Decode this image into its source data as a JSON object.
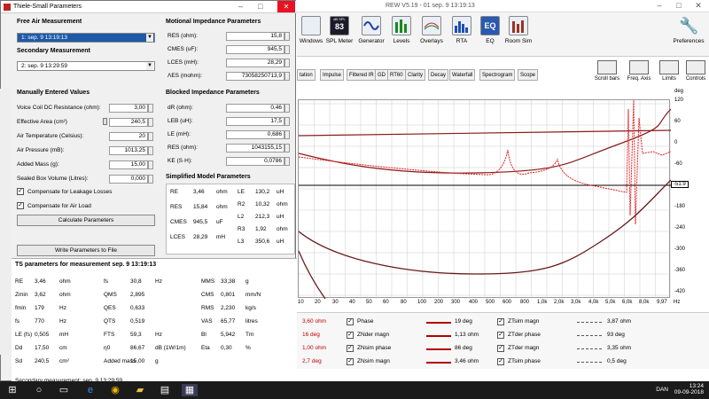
{
  "app": {
    "title": "REW V5.19 - 01 sep. 9 13:19:13",
    "toolbar": [
      {
        "label": "Windows",
        "icon": "windows-icon"
      },
      {
        "label": "SPL Meter",
        "icon": "spl-meter-icon",
        "value": "83",
        "unit": "dB SPL"
      },
      {
        "label": "Generator",
        "icon": "generator-icon"
      },
      {
        "label": "Levels",
        "icon": "levels-icon"
      },
      {
        "label": "Overlays",
        "icon": "overlays-icon"
      },
      {
        "label": "RTA",
        "icon": "rta-icon"
      },
      {
        "label": "EQ",
        "icon": "eq-icon"
      },
      {
        "label": "Room Sim",
        "icon": "room-sim-icon"
      }
    ],
    "preferences": "Preferences",
    "tabs": [
      "tation",
      "Impulse",
      "Filtered IR",
      "GD",
      "RT60",
      "Clarity",
      "Decay",
      "Waterfall",
      "Spectrogram",
      "Scope"
    ],
    "right_tools": [
      "Scroll bars",
      "Freq. Axis",
      "Limits",
      "Controls"
    ],
    "graph": {
      "right_unit": "deg",
      "right_ticks": [
        "120",
        "60",
        "0",
        "-60",
        "-120",
        "-180",
        "-240",
        "-300",
        "-360",
        "-420"
      ],
      "marker": "-51.9",
      "x_ticks": [
        "10",
        "20",
        "30",
        "40",
        "50",
        "60",
        "80",
        "100",
        "200",
        "300",
        "400",
        "500",
        "600",
        "800",
        "1,0k",
        "2,0k",
        "3,0k",
        "4,0k",
        "5,0k",
        "6,0k",
        "8,0k",
        "9,97",
        "Hz"
      ]
    },
    "legend": [
      {
        "left_value": "3,60 ohm",
        "name": "Phase",
        "value": "19 deg",
        "name2": "ZTsim magn",
        "value2": "3,87 ohm"
      },
      {
        "left_value": "16 deg",
        "name": "ZNder magn",
        "value": "1,13 ohm",
        "name2": "ZTder phase",
        "value2": "93 deg"
      },
      {
        "left_value": "1,00 ohm",
        "name": "ZNsim phase",
        "value": "86 deg",
        "name2": "ZTder magn",
        "value2": "3,35 ohm"
      },
      {
        "left_value": "2,7 deg",
        "name": "ZNsim magn",
        "value": "3,46 ohm",
        "name2": "ZTsim phase",
        "value2": "0,5 deg"
      }
    ]
  },
  "dialog": {
    "title": "Thiele-Small Parameters",
    "free_air": {
      "heading": "Free Air Measurement",
      "value": "1: sep. 9 13:19:13"
    },
    "secondary": {
      "heading": "Secondary Measurement",
      "value": "2: sep. 9 13:29:59"
    },
    "manual": {
      "heading": "Manually Entered Values",
      "rows": [
        {
          "label": "Voice Coil DC Resistance (ohm):",
          "value": "3,00"
        },
        {
          "label": "Effective Area (cm²)",
          "value": "240,5"
        },
        {
          "label": "Air Temperature (Celsius):",
          "value": "20"
        },
        {
          "label": "Air Pressure (mB):",
          "value": "1013,25"
        },
        {
          "label": "Added Mass (g):",
          "value": "15,00"
        },
        {
          "label": "Sealed Box Volume (Litres):",
          "value": "0,000"
        }
      ],
      "compensate_leakage": "Compensate for Leakage Losses",
      "compensate_air": "Compensate for Air Load",
      "calculate": "Calculate Parameters",
      "write": "Write Parameters to File"
    },
    "motional": {
      "heading": "Motional Impedance Parameters",
      "rows": [
        {
          "label": "RES (ohm):",
          "value": "15,8"
        },
        {
          "label": "CMES (uF):",
          "value": "945,5"
        },
        {
          "label": "LCES (mH):",
          "value": "28,29"
        },
        {
          "label": "ΛES (mohm):",
          "value": "73058250713,9"
        }
      ]
    },
    "blocked": {
      "heading": "Blocked Impedance Parameters",
      "rows": [
        {
          "label": "dR (ohm):",
          "value": "0,46"
        },
        {
          "label": "LEB (uH):",
          "value": "17,5"
        },
        {
          "label": "LE (mH):",
          "value": "0,686"
        },
        {
          "label": "RES (ohm):",
          "value": "1043155,15"
        },
        {
          "label": "KE (S·H):",
          "value": "0,0786"
        }
      ]
    },
    "simplified": {
      "heading": "Simplified Model Parameters",
      "left": [
        {
          "label": "RE",
          "value": "3,46",
          "unit": "ohm"
        },
        {
          "label": "RES",
          "value": "15,84",
          "unit": "ohm"
        },
        {
          "label": "CMES",
          "value": "945,5",
          "unit": "uF"
        },
        {
          "label": "LCES",
          "value": "28,29",
          "unit": "mH"
        }
      ],
      "right": [
        {
          "label": "LE",
          "value": "130,2",
          "unit": "uH"
        },
        {
          "label": "R2",
          "value": "10,32",
          "unit": "ohm"
        },
        {
          "label": "L2",
          "value": "212,3",
          "unit": "uH"
        },
        {
          "label": "R3",
          "value": "1,92",
          "unit": "ohm"
        },
        {
          "label": "L3",
          "value": "350,6",
          "unit": "uH"
        }
      ]
    },
    "ts": {
      "heading": "TS parameters for measurement sep. 9 13:19:13",
      "col1": [
        {
          "label": "RE",
          "value": "3,46",
          "unit": "ohm"
        },
        {
          "label": "Zmin",
          "value": "3,62",
          "unit": "ohm"
        },
        {
          "label": "fmin",
          "value": "179",
          "unit": "Hz"
        },
        {
          "label": "fs",
          "value": "770",
          "unit": "Hz"
        },
        {
          "label": "LE (fs)",
          "value": "0,505",
          "unit": "mH"
        },
        {
          "label": "Dd",
          "value": "17,50",
          "unit": "cm"
        },
        {
          "label": "Sd",
          "value": "240,5",
          "unit": "cm²"
        }
      ],
      "col2": [
        {
          "label": "fs",
          "value": "30,8",
          "unit": "Hz"
        },
        {
          "label": "QMS",
          "value": "2,895",
          "unit": ""
        },
        {
          "label": "QES",
          "value": "0,633",
          "unit": ""
        },
        {
          "label": "QTS",
          "value": "0,519",
          "unit": ""
        },
        {
          "label": "FTS",
          "value": "59,3",
          "unit": "Hz"
        },
        {
          "label": "η0",
          "value": "86,67",
          "unit": "dB (1W/1m)"
        },
        {
          "label": "Added mass",
          "value": "15,00",
          "unit": "g"
        }
      ],
      "col3": [
        {
          "label": "MMS",
          "value": "33,38",
          "unit": "g"
        },
        {
          "label": "CMS",
          "value": "0,801",
          "unit": "mm/N"
        },
        {
          "label": "RMS",
          "value": "2,230",
          "unit": "kg/s"
        },
        {
          "label": "VAS",
          "value": "65,77",
          "unit": "litres"
        },
        {
          "label": "Bl",
          "value": "5,942",
          "unit": "Tm"
        },
        {
          "label": "Eta",
          "value": "0,30",
          "unit": "%"
        }
      ],
      "footer": "Secondary measurement: sep. 9 13:29:59"
    }
  },
  "taskbar": {
    "time": "13:24",
    "date": "09-09-2018",
    "lang": "DAN"
  }
}
